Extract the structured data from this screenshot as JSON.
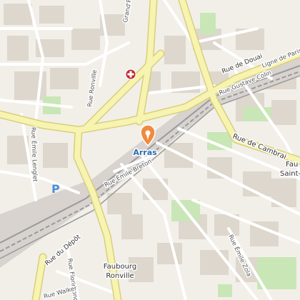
{
  "map": {
    "city": "Arras",
    "streets": {
      "rue_de_douai": "Rue de Douai",
      "rue_gustave_colin": "Rue Gustave Colin",
      "ligne_de_paris": "Ligne de Paris",
      "rue_de_cambrai": "Rue de Cambrai",
      "rue_emile_breton": "Rue Émile Breton",
      "rue_emile_lenglet": "Rue Émile Lenglet",
      "rue_ronville": "Rue Ronville",
      "grand_place": "Grand'P",
      "rue_du_depot": "Rue du Dépôt",
      "rue_florimond": "Rue Florimond Ro",
      "rue_walker": "Rue Walker",
      "rue_emile_zola": "Rue Émile Zola"
    },
    "districts": {
      "faubourg_ronville_1": "Faubourg",
      "faubourg_ronville_2": "Ronville",
      "fau_right": "Fau",
      "saint_right": "Saint-"
    },
    "parking_letter": "P",
    "colors": {
      "background": "#f2efe9",
      "major_road": "#f7f3b0",
      "major_road_casing": "#d9cf7a",
      "minor_road": "#ffffff",
      "block": "#ddd7cd",
      "park": "#c9e6b7",
      "rail": "#9a9a9a",
      "city_label": "#2b6cb0",
      "pin": "#f28a3c",
      "hospital": "#c0282d",
      "parking": "#4a90d9"
    },
    "icons": [
      "location-pin-icon",
      "hospital-icon",
      "parking-icon"
    ]
  }
}
